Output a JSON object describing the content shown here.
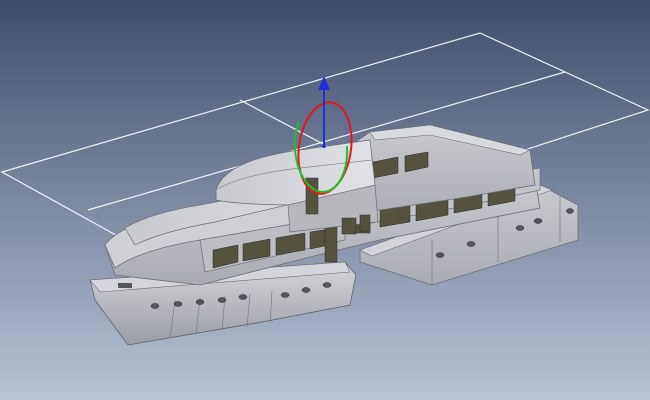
{
  "viewport": {
    "background_top": "#3f4d6d",
    "background_bottom": "#b9c3d6",
    "plane_color": "#ffffff",
    "model_color": "#c4c6cc",
    "gizmo": {
      "axis_color": "#1f2fd6",
      "ring_red": "#e0191e",
      "ring_green": "#1fbf2a"
    }
  }
}
